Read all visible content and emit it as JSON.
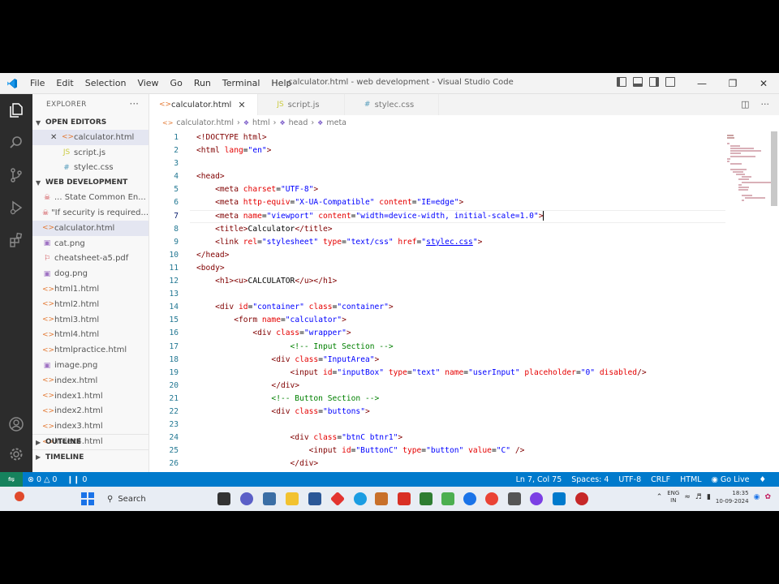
{
  "titlebar": {
    "menu": [
      "File",
      "Edit",
      "Selection",
      "View",
      "Go",
      "Run",
      "Terminal",
      "Help"
    ],
    "title": "calculator.html - web development - Visual Studio Code"
  },
  "sidebar": {
    "explorer_label": "EXPLORER",
    "open_editors_label": "OPEN EDITORS",
    "open_editors": [
      {
        "name": "calculator.html",
        "type": "html",
        "active": true,
        "closable": true
      },
      {
        "name": "script.js",
        "type": "js"
      },
      {
        "name": "stylec.css",
        "type": "css"
      }
    ],
    "workspace_label": "WEB DEVELOPMENT",
    "files": [
      {
        "name": "... State Common En...",
        "type": "doc"
      },
      {
        "name": "\"If security is required...",
        "type": "doc"
      },
      {
        "name": "calculator.html",
        "type": "html",
        "active": true
      },
      {
        "name": "cat.png",
        "type": "img"
      },
      {
        "name": "cheatsheet-a5.pdf",
        "type": "pdf"
      },
      {
        "name": "dog.png",
        "type": "img"
      },
      {
        "name": "html1.html",
        "type": "html"
      },
      {
        "name": "html2.html",
        "type": "html"
      },
      {
        "name": "html3.html",
        "type": "html"
      },
      {
        "name": "html4.html",
        "type": "html"
      },
      {
        "name": "htmlpractice.html",
        "type": "html"
      },
      {
        "name": "image.png",
        "type": "img"
      },
      {
        "name": "index.html",
        "type": "html"
      },
      {
        "name": "index1.html",
        "type": "html"
      },
      {
        "name": "index2.html",
        "type": "html"
      },
      {
        "name": "index3.html",
        "type": "html"
      },
      {
        "name": "index4.html",
        "type": "html"
      }
    ],
    "outline_label": "OUTLINE",
    "timeline_label": "TIMELINE"
  },
  "editor": {
    "tabs": [
      {
        "label": "calculator.html",
        "active": true,
        "type": "html"
      },
      {
        "label": "script.js",
        "active": false,
        "type": "js"
      },
      {
        "label": "stylec.css",
        "active": false,
        "type": "css"
      }
    ],
    "breadcrumb": [
      "calculator.html",
      "html",
      "head",
      "meta"
    ],
    "current_line": 7,
    "lines": [
      {
        "n": "1",
        "indent": "",
        "tokens": [
          [
            "t-tag",
            "<!DOCTYPE html>"
          ]
        ]
      },
      {
        "n": "2",
        "indent": "",
        "tokens": [
          [
            "t-tag",
            "<html "
          ],
          [
            "t-attr",
            "lang"
          ],
          [
            "t-text",
            "="
          ],
          [
            "t-val",
            "\"en\""
          ],
          [
            "t-tag",
            ">"
          ]
        ]
      },
      {
        "n": "3",
        "indent": "",
        "tokens": []
      },
      {
        "n": "4",
        "indent": "",
        "tokens": [
          [
            "t-tag",
            "<head>"
          ]
        ]
      },
      {
        "n": "5",
        "indent": "    ",
        "tokens": [
          [
            "t-tag",
            "<meta "
          ],
          [
            "t-attr",
            "charset"
          ],
          [
            "t-text",
            "="
          ],
          [
            "t-val",
            "\"UTF-8\""
          ],
          [
            "t-tag",
            ">"
          ]
        ]
      },
      {
        "n": "6",
        "indent": "    ",
        "tokens": [
          [
            "t-tag",
            "<meta "
          ],
          [
            "t-attr",
            "http-equiv"
          ],
          [
            "t-text",
            "="
          ],
          [
            "t-val",
            "\"X-UA-Compatible\""
          ],
          [
            "t-text",
            " "
          ],
          [
            "t-attr",
            "content"
          ],
          [
            "t-text",
            "="
          ],
          [
            "t-val",
            "\"IE=edge\""
          ],
          [
            "t-tag",
            ">"
          ]
        ]
      },
      {
        "n": "7",
        "indent": "    ",
        "tokens": [
          [
            "t-tag",
            "<meta "
          ],
          [
            "t-attr",
            "name"
          ],
          [
            "t-text",
            "="
          ],
          [
            "t-val",
            "\"viewport\""
          ],
          [
            "t-text",
            " "
          ],
          [
            "t-attr",
            "content"
          ],
          [
            "t-text",
            "="
          ],
          [
            "t-val",
            "\"width=device-width, initial-scale=1.0\""
          ],
          [
            "t-tag",
            ">"
          ]
        ]
      },
      {
        "n": "8",
        "indent": "    ",
        "tokens": [
          [
            "t-tag",
            "<title>"
          ],
          [
            "t-text",
            "Calculator"
          ],
          [
            "t-tag",
            "</title>"
          ]
        ]
      },
      {
        "n": "9",
        "indent": "    ",
        "tokens": [
          [
            "t-tag",
            "<link "
          ],
          [
            "t-attr",
            "rel"
          ],
          [
            "t-text",
            "="
          ],
          [
            "t-val",
            "\"stylesheet\""
          ],
          [
            "t-text",
            " "
          ],
          [
            "t-attr",
            "type"
          ],
          [
            "t-text",
            "="
          ],
          [
            "t-val",
            "\"text/css\""
          ],
          [
            "t-text",
            " "
          ],
          [
            "t-attr",
            "href"
          ],
          [
            "t-text",
            "="
          ],
          [
            "t-val",
            "\""
          ],
          [
            "t-link",
            "stylec.css"
          ],
          [
            "t-val",
            "\""
          ],
          [
            "t-tag",
            ">"
          ]
        ]
      },
      {
        "n": "10",
        "indent": "",
        "tokens": [
          [
            "t-tag",
            "</head>"
          ]
        ]
      },
      {
        "n": "11",
        "indent": "",
        "tokens": [
          [
            "t-tag",
            "<body>"
          ]
        ]
      },
      {
        "n": "12",
        "indent": "    ",
        "tokens": [
          [
            "t-tag",
            "<h1><u>"
          ],
          [
            "t-text",
            "CALCULATOR"
          ],
          [
            "t-tag",
            "</u></h1>"
          ]
        ]
      },
      {
        "n": "13",
        "indent": "",
        "tokens": []
      },
      {
        "n": "14",
        "indent": "    ",
        "tokens": [
          [
            "t-tag",
            "<div "
          ],
          [
            "t-attr",
            "id"
          ],
          [
            "t-text",
            "="
          ],
          [
            "t-val",
            "\"container\""
          ],
          [
            "t-text",
            " "
          ],
          [
            "t-attr",
            "class"
          ],
          [
            "t-text",
            "="
          ],
          [
            "t-val",
            "\"container\""
          ],
          [
            "t-tag",
            ">"
          ]
        ]
      },
      {
        "n": "15",
        "indent": "        ",
        "tokens": [
          [
            "t-tag",
            "<form "
          ],
          [
            "t-attr",
            "name"
          ],
          [
            "t-text",
            "="
          ],
          [
            "t-val",
            "\"calculator\""
          ],
          [
            "t-tag",
            ">"
          ]
        ]
      },
      {
        "n": "16",
        "indent": "            ",
        "tokens": [
          [
            "t-tag",
            "<div "
          ],
          [
            "t-attr",
            "class"
          ],
          [
            "t-text",
            "="
          ],
          [
            "t-val",
            "\"wrapper\""
          ],
          [
            "t-tag",
            ">"
          ]
        ]
      },
      {
        "n": "17",
        "indent": "                    ",
        "tokens": [
          [
            "t-com",
            "<!-- Input Section -->"
          ]
        ]
      },
      {
        "n": "18",
        "indent": "                ",
        "tokens": [
          [
            "t-tag",
            "<div "
          ],
          [
            "t-attr",
            "class"
          ],
          [
            "t-text",
            "="
          ],
          [
            "t-val",
            "\"InputArea\""
          ],
          [
            "t-tag",
            ">"
          ]
        ]
      },
      {
        "n": "19",
        "indent": "                    ",
        "tokens": [
          [
            "t-tag",
            "<input "
          ],
          [
            "t-attr",
            "id"
          ],
          [
            "t-text",
            "="
          ],
          [
            "t-val",
            "\"inputBox\""
          ],
          [
            "t-text",
            " "
          ],
          [
            "t-attr",
            "type"
          ],
          [
            "t-text",
            "="
          ],
          [
            "t-val",
            "\"text\""
          ],
          [
            "t-text",
            " "
          ],
          [
            "t-attr",
            "name"
          ],
          [
            "t-text",
            "="
          ],
          [
            "t-val",
            "\"userInput\""
          ],
          [
            "t-text",
            " "
          ],
          [
            "t-attr",
            "placeholder"
          ],
          [
            "t-text",
            "="
          ],
          [
            "t-val",
            "\"0\""
          ],
          [
            "t-text",
            " "
          ],
          [
            "t-attr",
            "disabled"
          ],
          [
            "t-tag",
            "/>"
          ]
        ]
      },
      {
        "n": "20",
        "indent": "                ",
        "tokens": [
          [
            "t-tag",
            "</div>"
          ]
        ]
      },
      {
        "n": "21",
        "indent": "                ",
        "tokens": [
          [
            "t-com",
            "<!-- Button Section -->"
          ]
        ]
      },
      {
        "n": "22",
        "indent": "                ",
        "tokens": [
          [
            "t-tag",
            "<div "
          ],
          [
            "t-attr",
            "class"
          ],
          [
            "t-text",
            "="
          ],
          [
            "t-val",
            "\"buttons\""
          ],
          [
            "t-tag",
            ">"
          ]
        ]
      },
      {
        "n": "23",
        "indent": "",
        "tokens": []
      },
      {
        "n": "24",
        "indent": "                    ",
        "tokens": [
          [
            "t-tag",
            "<div "
          ],
          [
            "t-attr",
            "class"
          ],
          [
            "t-text",
            "="
          ],
          [
            "t-val",
            "\"btnC btnr1\""
          ],
          [
            "t-tag",
            ">"
          ]
        ]
      },
      {
        "n": "25",
        "indent": "                        ",
        "tokens": [
          [
            "t-tag",
            "<input "
          ],
          [
            "t-attr",
            "id"
          ],
          [
            "t-text",
            "="
          ],
          [
            "t-val",
            "\"ButtonC\""
          ],
          [
            "t-text",
            " "
          ],
          [
            "t-attr",
            "type"
          ],
          [
            "t-text",
            "="
          ],
          [
            "t-val",
            "\"button\""
          ],
          [
            "t-text",
            " "
          ],
          [
            "t-attr",
            "value"
          ],
          [
            "t-text",
            "="
          ],
          [
            "t-val",
            "\"C\""
          ],
          [
            "t-text",
            " "
          ],
          [
            "t-tag",
            "/>"
          ]
        ]
      },
      {
        "n": "26",
        "indent": "                    ",
        "tokens": [
          [
            "t-tag",
            "</div>"
          ]
        ]
      }
    ]
  },
  "statusbar": {
    "errors": "0",
    "warnings": "0",
    "ports": "0",
    "position": "Ln 7, Col 75",
    "spaces": "Spaces: 4",
    "encoding": "UTF-8",
    "eol": "CRLF",
    "language": "HTML",
    "golive": "Go Live"
  },
  "taskbar": {
    "search_label": "Search",
    "lang": "ENG",
    "region": "IN",
    "time": "18:35",
    "date": "10-09-2024"
  },
  "colors": {
    "accent": "#007acc",
    "activitybar": "#2c2c2c",
    "remote": "#16825d"
  }
}
